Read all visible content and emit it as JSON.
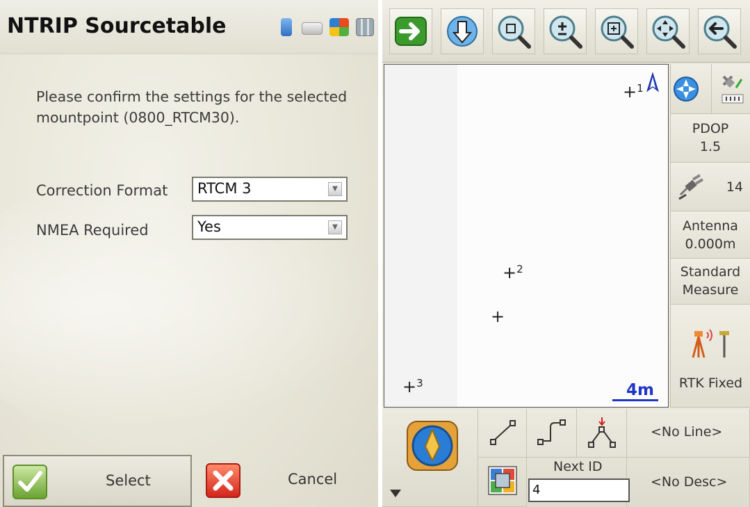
{
  "dialog": {
    "title": "NTRIP Sourcetable",
    "message": "Please confirm the settings for the selected mountpoint (0800_RTCM30).",
    "fields": [
      {
        "label": "Correction Format",
        "value": "RTCM 3"
      },
      {
        "label": "NMEA Required",
        "value": "Yes"
      }
    ],
    "select_label": "Select",
    "cancel_label": "Cancel",
    "status_icons": [
      "battery-icon",
      "keyboard-icon",
      "windows-flag-icon",
      "grid-icon"
    ]
  },
  "survey": {
    "toolbar_icons": [
      "arrow-right-icon",
      "download-globe-icon",
      "zoom-extents-icon",
      "zoom-in-out-icon",
      "zoom-window-icon",
      "pan-icon",
      "back-icon"
    ],
    "map": {
      "points": [
        {
          "label": "1"
        },
        {
          "label": "2"
        },
        {
          "label": ""
        },
        {
          "label": "3"
        }
      ],
      "scale_label": "4m"
    },
    "side": {
      "pdop_label": "PDOP",
      "pdop_value": "1.5",
      "satellites": "14",
      "antenna_label": "Antenna",
      "antenna_value": "0.000m",
      "measure_line1": "Standard",
      "measure_line2": "Measure",
      "rtk_status": "RTK Fixed"
    },
    "bottom": {
      "line_label": "<No Line>",
      "desc_label": "<No Desc>",
      "next_id_label": "Next ID",
      "next_id_value": "4"
    }
  },
  "colors": {
    "scale_blue": "#1f35c6",
    "ok_green": "#6aa332",
    "cancel_red": "#d3261b"
  }
}
